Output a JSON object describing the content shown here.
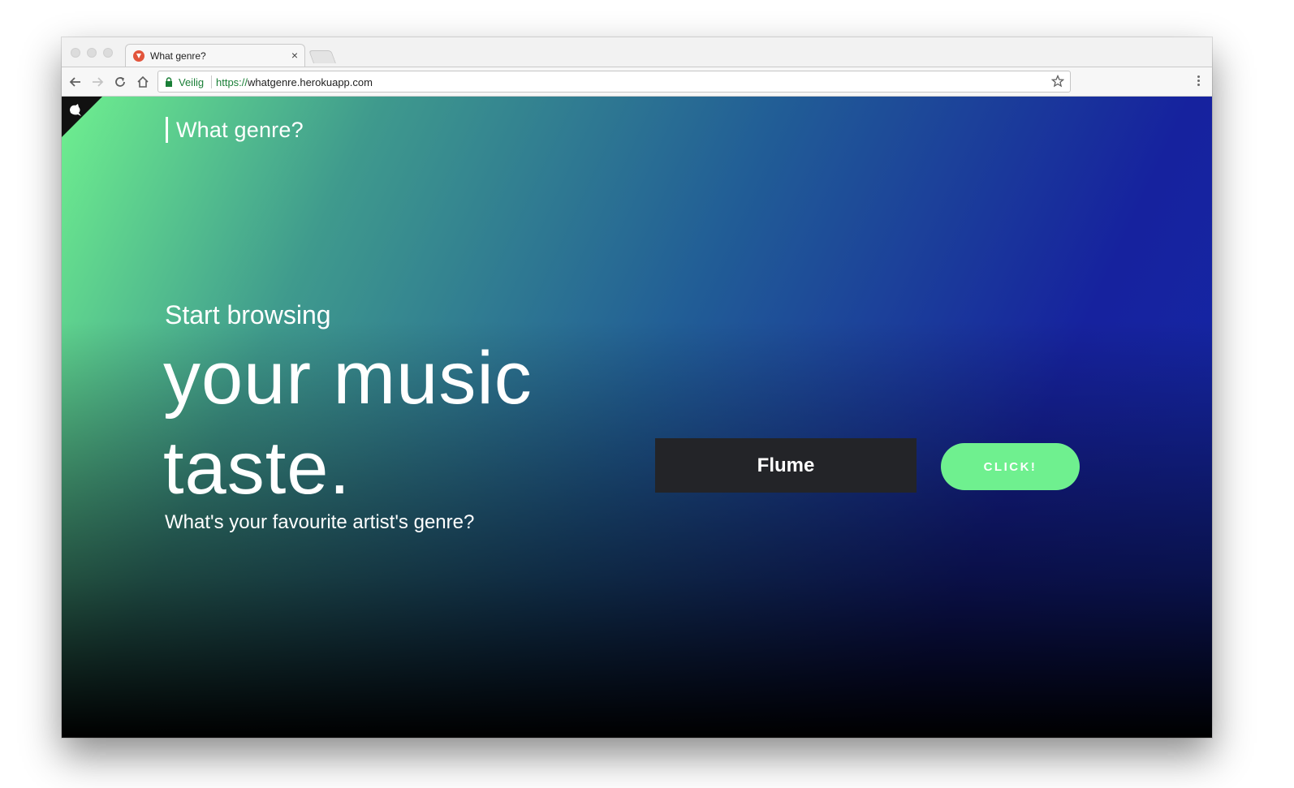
{
  "browser": {
    "tab": {
      "title": "What genre?",
      "close_glyph": "×",
      "favicon": "brand-favicon-icon"
    },
    "address_bar": {
      "secure_label": "Veilig",
      "url_scheme": "https://",
      "url_host": "whatgenre.herokuapp.com"
    },
    "icons": [
      "back-icon",
      "forward-icon",
      "reload-icon",
      "home-icon",
      "lock-icon",
      "bookmark-star-icon",
      "menu-icon"
    ]
  },
  "page": {
    "brand_title": "What genre?",
    "hero": {
      "kicker": "Start browsing",
      "line1": "your music",
      "line2": "taste.",
      "subtitle": "What's your favourite artist's genre?"
    },
    "form": {
      "artist_value": "Flume",
      "button_label": "CLICK!"
    },
    "colors": {
      "accent": "#6ff08f",
      "input_bg": "#232428",
      "gradient_start": "#6ff08f",
      "gradient_end": "#1428a8"
    }
  }
}
